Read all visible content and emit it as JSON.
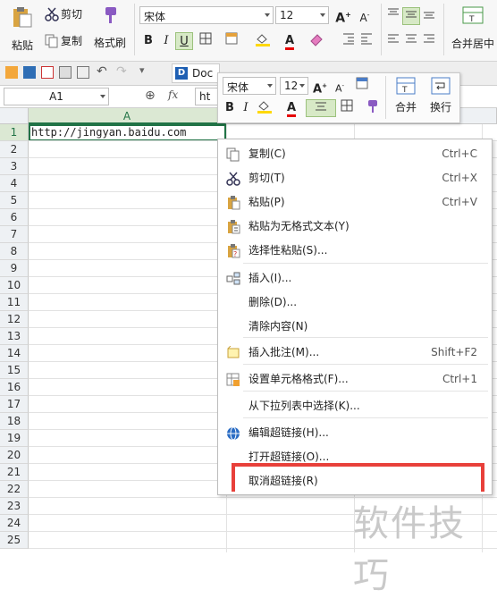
{
  "ribbon": {
    "paste_label": "粘贴",
    "cut_label": "剪切",
    "copy_label": "复制",
    "format_painter_label": "格式刷",
    "font_name": "宋体",
    "font_size": "12",
    "bold": "B",
    "italic": "I",
    "underline": "U",
    "grow_font": "A",
    "shrink_font": "A",
    "merge_label": "合并居中"
  },
  "quick_toolbar": {
    "doc_tab_label": "Doc"
  },
  "formula_bar": {
    "cell_ref": "A1",
    "fx": "fx",
    "content_prefix": "ht"
  },
  "grid": {
    "columns": [
      "A"
    ],
    "rows": [
      "1",
      "2",
      "3",
      "4",
      "5",
      "6",
      "7",
      "8",
      "9",
      "10",
      "11",
      "12",
      "13",
      "14",
      "15",
      "16",
      "17",
      "18",
      "19",
      "20",
      "21",
      "22",
      "23",
      "24",
      "25"
    ],
    "cell_a1": "http://jingyan.baidu.com"
  },
  "mini_toolbar": {
    "font_name": "宋体",
    "font_size": "12",
    "merge_label": "合并",
    "wrap_label": "换行"
  },
  "context_menu": {
    "items": [
      {
        "label": "复制(C)",
        "shortcut": "Ctrl+C",
        "icon": "copy-icon"
      },
      {
        "label": "剪切(T)",
        "shortcut": "Ctrl+X",
        "icon": "scissors-icon"
      },
      {
        "label": "粘贴(P)",
        "shortcut": "Ctrl+V",
        "icon": "paste-icon"
      },
      {
        "label": "粘贴为无格式文本(Y)",
        "shortcut": "",
        "icon": "paste-text-icon"
      },
      {
        "label": "选择性粘贴(S)...",
        "shortcut": "",
        "icon": "paste-special-icon"
      },
      {
        "label": "插入(I)...",
        "shortcut": "",
        "icon": "insert-icon"
      },
      {
        "label": "删除(D)...",
        "shortcut": "",
        "icon": ""
      },
      {
        "label": "清除内容(N)",
        "shortcut": "",
        "icon": ""
      },
      {
        "label": "插入批注(M)...",
        "shortcut": "Shift+F2",
        "icon": "comment-icon"
      },
      {
        "label": "设置单元格格式(F)...",
        "shortcut": "Ctrl+1",
        "icon": "format-cells-icon"
      },
      {
        "label": "从下拉列表中选择(K)...",
        "shortcut": "",
        "icon": ""
      },
      {
        "label": "编辑超链接(H)...",
        "shortcut": "",
        "icon": "hyperlink-icon"
      },
      {
        "label": "打开超链接(O)...",
        "shortcut": "",
        "icon": ""
      },
      {
        "label": "取消超链接(R)",
        "shortcut": "",
        "icon": ""
      }
    ]
  },
  "watermark": "软件技巧",
  "colors": {
    "grid_header_bg": "#eef1f4",
    "selection_green": "#217346",
    "highlight_red": "#e8403a",
    "font_color_red": "#e60000",
    "fill_yellow": "#ffd800"
  }
}
